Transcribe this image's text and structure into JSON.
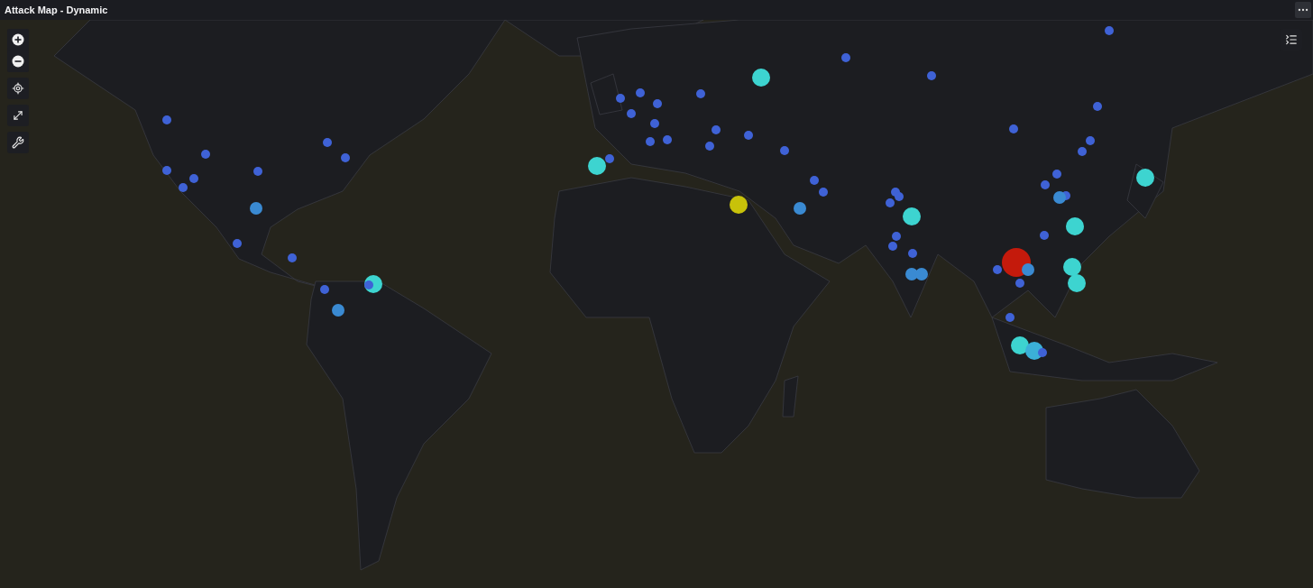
{
  "panel": {
    "title": "Attack Map - Dynamic"
  },
  "markers": [
    {
      "kind": "small",
      "color": "#3f62d6"
    },
    {
      "kind": "small",
      "color": "#3f62d6"
    },
    {
      "kind": "large",
      "color": "#3dd4d0"
    },
    {
      "kind": "small",
      "color": "#3f62d6"
    },
    {
      "kind": "small",
      "color": "#3f62d6"
    },
    {
      "kind": "small",
      "color": "#3f62d6"
    },
    {
      "kind": "small",
      "color": "#3f62d6"
    },
    {
      "kind": "small",
      "color": "#3f62d6"
    },
    {
      "kind": "small",
      "color": "#3f62d6"
    },
    {
      "kind": "small",
      "color": "#3f62d6"
    },
    {
      "kind": "small",
      "color": "#3f62d6"
    },
    {
      "kind": "small",
      "color": "#3f62d6"
    },
    {
      "kind": "small",
      "color": "#3f62d6"
    },
    {
      "kind": "small",
      "color": "#3f62d6"
    },
    {
      "kind": "small",
      "color": "#3f62d6"
    },
    {
      "kind": "small",
      "color": "#3f62d6"
    },
    {
      "kind": "small",
      "color": "#3f62d6"
    },
    {
      "kind": "small",
      "color": "#3f62d6"
    },
    {
      "kind": "small",
      "color": "#3f62d6"
    },
    {
      "kind": "small",
      "color": "#3f62d6"
    },
    {
      "kind": "small",
      "color": "#3f62d6"
    },
    {
      "kind": "small",
      "color": "#3f62d6"
    },
    {
      "kind": "large",
      "color": "#3dd4d0"
    },
    {
      "kind": "small",
      "color": "#3f62d6"
    },
    {
      "kind": "small",
      "color": "#3f62d6"
    },
    {
      "kind": "small",
      "color": "#3f62d6"
    },
    {
      "kind": "small",
      "color": "#3f62d6"
    },
    {
      "kind": "small",
      "color": "#3f62d6"
    },
    {
      "kind": "small",
      "color": "#3f62d6"
    },
    {
      "kind": "small",
      "color": "#3f62d6"
    },
    {
      "kind": "large",
      "color": "#3dd4d0"
    },
    {
      "kind": "small",
      "color": "#3f62d6"
    },
    {
      "kind": "small",
      "color": "#3f62d6"
    },
    {
      "kind": "small",
      "color": "#3f62d6"
    },
    {
      "kind": "small",
      "color": "#3f62d6"
    },
    {
      "kind": "small",
      "color": "#3f62d6"
    },
    {
      "kind": "large",
      "color": "#c8c20a"
    },
    {
      "kind": "medium",
      "color": "#3a8ad2"
    },
    {
      "kind": "large",
      "color": "#3dd4d0"
    },
    {
      "kind": "small",
      "color": "#3f62d6"
    },
    {
      "kind": "small",
      "color": "#3f62d6"
    },
    {
      "kind": "small",
      "color": "#3f62d6"
    },
    {
      "kind": "medium",
      "color": "#3a8ad2"
    },
    {
      "kind": "large",
      "color": "#3dd4d0"
    },
    {
      "kind": "medium",
      "color": "#3a8ad2"
    },
    {
      "kind": "small",
      "color": "#3f62d6"
    },
    {
      "kind": "small",
      "color": "#3f62d6"
    },
    {
      "kind": "small",
      "color": "#3f62d6"
    },
    {
      "kind": "small",
      "color": "#3f62d6"
    },
    {
      "kind": "small",
      "color": "#3f62d6"
    },
    {
      "kind": "small",
      "color": "#3f62d6"
    },
    {
      "kind": "huge",
      "color": "#c41a0c"
    },
    {
      "kind": "medium",
      "color": "#3a8ad2"
    },
    {
      "kind": "small",
      "color": "#3f62d6"
    },
    {
      "kind": "small",
      "color": "#3f62d6"
    },
    {
      "kind": "large",
      "color": "#3dd4d0"
    },
    {
      "kind": "large",
      "color": "#3dd4d0"
    },
    {
      "kind": "medium",
      "color": "#3a8ad2"
    },
    {
      "kind": "medium",
      "color": "#3a8ad2"
    },
    {
      "kind": "large",
      "color": "#3dd4d0"
    },
    {
      "kind": "small",
      "color": "#3f62d6"
    },
    {
      "kind": "small",
      "color": "#3f62d6"
    },
    {
      "kind": "medium",
      "color": "#3a8ad2"
    },
    {
      "kind": "small",
      "color": "#3f62d6"
    },
    {
      "kind": "large",
      "color": "#3dd4d0"
    },
    {
      "kind": "large",
      "color": "#3bb0d8"
    },
    {
      "kind": "small",
      "color": "#3f62d6"
    }
  ]
}
